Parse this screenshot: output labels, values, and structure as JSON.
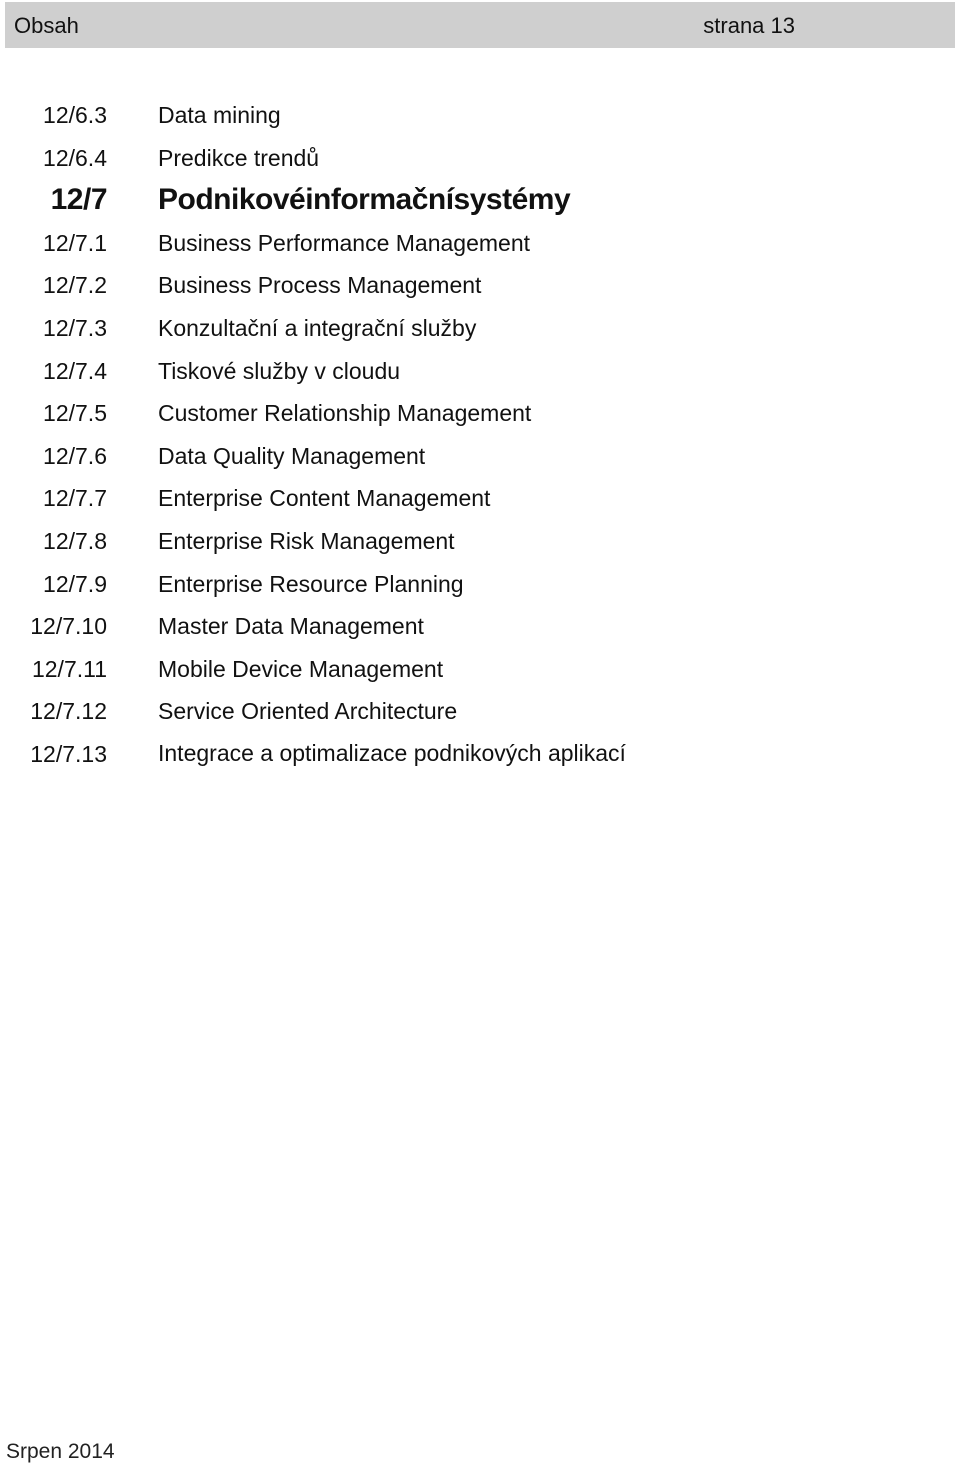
{
  "header": {
    "title": "Obsah",
    "page": "strana 13",
    "background": "#cfcfcf"
  },
  "toc": [
    {
      "num": "12/6.3",
      "title": "Data mining",
      "level": "section"
    },
    {
      "num": "12/6.4",
      "title": "Predikce trendů",
      "level": "section"
    },
    {
      "num": "12/7",
      "title": "Podnikovéinformačnísystémy",
      "level": "chapter"
    },
    {
      "num": "12/7.1",
      "title": "Business Performance Management",
      "level": "section"
    },
    {
      "num": "12/7.2",
      "title": "Business Process Management",
      "level": "section"
    },
    {
      "num": "12/7.3",
      "title": "Konzultační a integrační služby",
      "level": "section"
    },
    {
      "num": "12/7.4",
      "title": "Tiskové služby v cloudu",
      "level": "section"
    },
    {
      "num": "12/7.5",
      "title": "Customer Relationship Management",
      "level": "section"
    },
    {
      "num": "12/7.6",
      "title": "Data Quality Management",
      "level": "section"
    },
    {
      "num": "12/7.7",
      "title": "Enterprise Content Management",
      "level": "section"
    },
    {
      "num": "12/7.8",
      "title": "Enterprise Risk Management",
      "level": "section"
    },
    {
      "num": "12/7.9",
      "title": "Enterprise Resource Planning",
      "level": "section"
    },
    {
      "num": "12/7.10",
      "title": "Master Data Management",
      "level": "section"
    },
    {
      "num": "12/7.11",
      "title": "Mobile Device Management",
      "level": "section"
    },
    {
      "num": "12/7.12",
      "title": "Service Oriented Architecture",
      "level": "section"
    },
    {
      "num": "12/7.13",
      "title": "Integrace a optimalizace podnikových aplikací",
      "level": "section"
    }
  ],
  "footer": {
    "date": "Srpen 2014"
  }
}
